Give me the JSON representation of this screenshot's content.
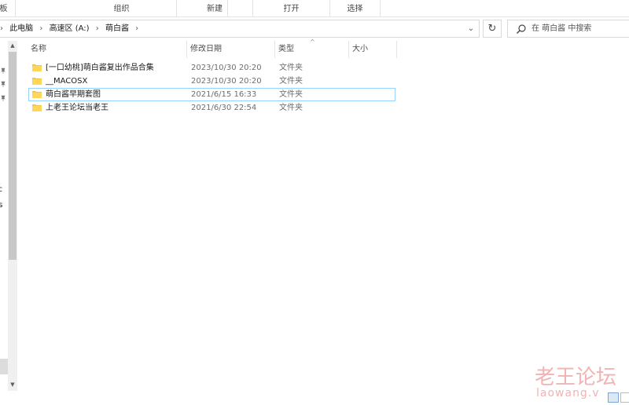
{
  "ribbon": {
    "groups": [
      "板",
      "组织",
      "新建",
      "打开",
      "选择"
    ]
  },
  "address": {
    "crumbs": [
      "此电脑",
      "高速区 (A:)",
      "萌白酱"
    ]
  },
  "search": {
    "placeholder": "在 萌白酱 中搜索"
  },
  "nav": {
    "partial_labels": [
      "ffic",
      "ers"
    ]
  },
  "columns": {
    "name": "名称",
    "date": "修改日期",
    "type": "类型",
    "size": "大小"
  },
  "files": [
    {
      "name": "[一口幼桃]萌白酱复出作品合集",
      "date": "2023/10/30 20:20",
      "type": "文件夹"
    },
    {
      "name": "__MACOSX",
      "date": "2023/10/30 20:20",
      "type": "文件夹"
    },
    {
      "name": "萌白酱早期套图",
      "date": "2021/6/15 16:33",
      "type": "文件夹"
    },
    {
      "name": "上老王论坛当老王",
      "date": "2021/6/30 22:54",
      "type": "文件夹"
    }
  ],
  "watermark": {
    "line1": "老王论坛",
    "line2": "laowang.v"
  },
  "colors": {
    "folder": "#f4c542",
    "focus_border": "#99d1ff",
    "watermark": "#f1b3b3"
  },
  "icons": [
    "folder-icon",
    "search-icon",
    "refresh-icon",
    "chevron-right-icon",
    "chevron-down-icon",
    "pin-icon"
  ]
}
